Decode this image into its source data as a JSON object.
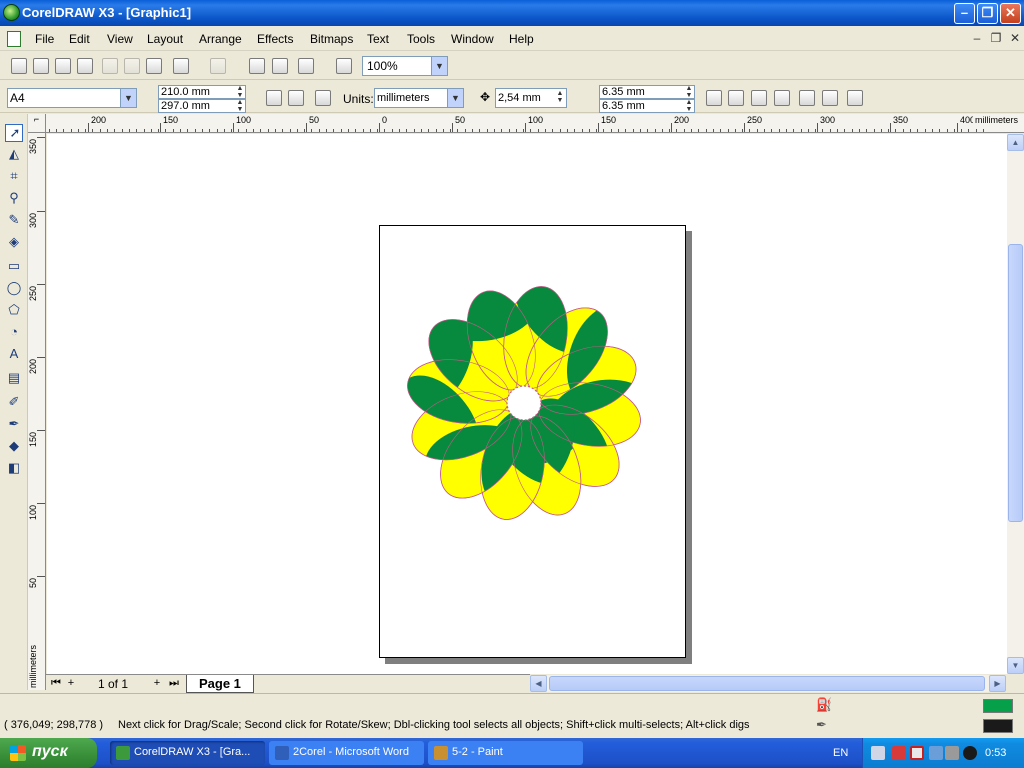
{
  "window": {
    "title": "CorelDRAW X3 - [Graphic1]",
    "min_glyph": "–",
    "max_glyph": "❐",
    "close_glyph": "✕"
  },
  "menu": {
    "items": [
      "File",
      "Edit",
      "View",
      "Layout",
      "Arrange",
      "Effects",
      "Bitmaps",
      "Text",
      "Tools",
      "Window",
      "Help"
    ],
    "mdi_min": "–",
    "mdi_restore": "❐",
    "mdi_close": "✕"
  },
  "toolbar": {
    "zoom": "100%"
  },
  "property_bar": {
    "paper_size": "A4",
    "width": "210.0 mm",
    "height": "297.0 mm",
    "units_label": "Units:",
    "units": "millimeters",
    "nudge": "2,54 mm",
    "dup_x": "6.35 mm",
    "dup_y": "6.35 mm"
  },
  "rulers": {
    "unit_label": "millimeters",
    "h_labels": [
      "200",
      "150",
      "100",
      "50",
      "0",
      "50",
      "100",
      "150",
      "200",
      "250",
      "300",
      "350",
      "400"
    ],
    "v_labels": [
      "350",
      "300",
      "250",
      "200",
      "150",
      "100",
      "50"
    ]
  },
  "toolbox": {
    "tools": [
      {
        "name": "pick-tool",
        "glyph": "➚"
      },
      {
        "name": "shape-tool",
        "glyph": "◭"
      },
      {
        "name": "crop-tool",
        "glyph": "⌗"
      },
      {
        "name": "zoom-tool",
        "glyph": "⚲"
      },
      {
        "name": "freehand-tool",
        "glyph": "✎"
      },
      {
        "name": "smart-fill-tool",
        "glyph": "◈"
      },
      {
        "name": "rectangle-tool",
        "glyph": "▭"
      },
      {
        "name": "ellipse-tool",
        "glyph": "◯"
      },
      {
        "name": "polygon-tool",
        "glyph": "⬠"
      },
      {
        "name": "basic-shapes-tool",
        "glyph": "◔"
      },
      {
        "name": "text-tool",
        "glyph": "A"
      },
      {
        "name": "interactive-blend-tool",
        "glyph": "▤"
      },
      {
        "name": "eyedropper-tool",
        "glyph": "✐"
      },
      {
        "name": "outline-tool",
        "glyph": "✒"
      },
      {
        "name": "fill-tool",
        "glyph": "◆"
      },
      {
        "name": "interactive-fill-tool",
        "glyph": "◧"
      }
    ]
  },
  "drawing": {
    "petal_count": 12,
    "petal_fill": "#FFFF00",
    "overlap_fill": "#07893E",
    "outline_color": "#C85A8A",
    "center_fill": "#FFFFFF"
  },
  "page_nav": {
    "first": "⏮",
    "prev_add": "+",
    "count": "1 of 1",
    "next_add": "+",
    "last": "⏭",
    "page_tab": "Page 1"
  },
  "status": {
    "coords": "( 376,049; 298,778 )",
    "hint": "Next click for Drag/Scale; Second click for Rotate/Skew; Dbl-clicking tool selects all objects; Shift+click multi-selects; Alt+click digs",
    "fill_color": "#07A04A",
    "outline_color": "#1A1A1A"
  },
  "taskbar": {
    "start": "пуск",
    "tasks": [
      {
        "label": "CorelDRAW X3 - [Gra...",
        "icon_color": "#3C9A3C"
      },
      {
        "label": "2Corel - Microsoft Word",
        "icon_color": "#2F5FB8"
      },
      {
        "label": "5-2 - Paint",
        "icon_color": "#C89030"
      }
    ],
    "language": "EN",
    "clock": "0:53"
  }
}
